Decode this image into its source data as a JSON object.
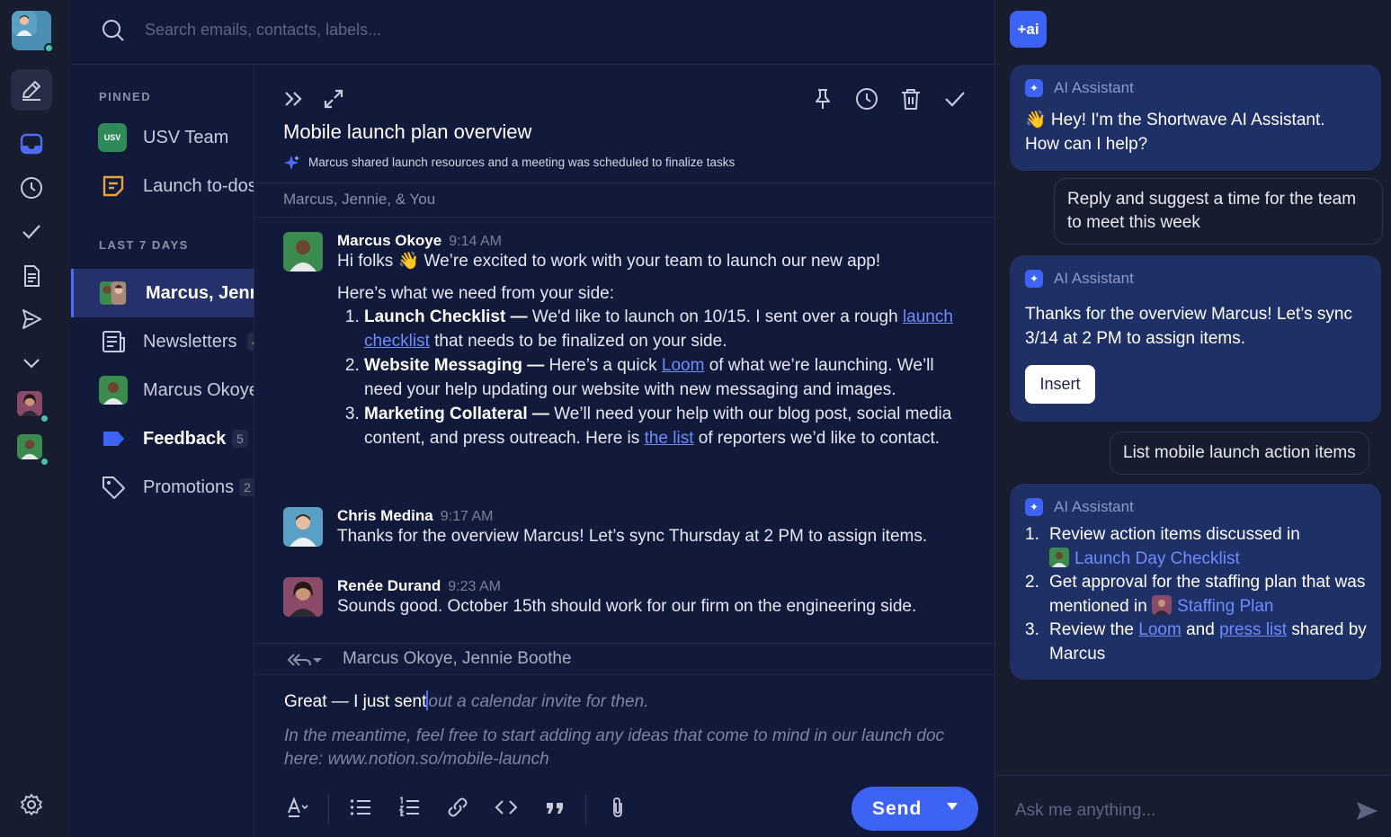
{
  "search": {
    "placeholder": "Search emails, contacts, labels..."
  },
  "sidebar": {
    "pinned_label": "PINNED",
    "last7_label": "LAST 7 DAYS",
    "pinned": [
      {
        "label": "USV Team",
        "avatar_text": "USV"
      },
      {
        "label": "Launch to-dos"
      }
    ],
    "recent": [
      {
        "label": "Marcus, Jennie"
      },
      {
        "label": "Newsletters",
        "count": "4"
      },
      {
        "label": "Marcus Okoye"
      },
      {
        "label": "Feedback",
        "count": "5"
      },
      {
        "label": "Promotions",
        "count": "2"
      }
    ]
  },
  "thread": {
    "title": "Mobile launch plan overview",
    "summary": "Marcus shared launch resources and a meeting was scheduled to finalize tasks",
    "participants": "Marcus, Jennie, & You",
    "messages": [
      {
        "name": "Marcus Okoye",
        "time": "9:14 AM",
        "greeting": "Hi folks 👋 We’re excited to work with your team to launch our new app!",
        "intro": "Here’s what we need from your side:",
        "items": [
          {
            "title": "Launch Checklist —",
            "pre": "We'd like to launch on 10/15. I sent over a rough",
            "link": "launch checklist",
            "post": "that needs to be finalized on your side."
          },
          {
            "title": "Website Messaging —",
            "pre": "Here’s a quick",
            "link": "Loom",
            "post": "of what we’re launching. We’ll need your help updating our website with new messaging and images."
          },
          {
            "title": "Marketing Collateral —",
            "pre": "We’ll need your help with our blog post, social media content, and press outreach. Here is",
            "link": "the list",
            "post": "of reporters we’d like to contact."
          }
        ]
      },
      {
        "name": "Chris Medina",
        "time": "9:17 AM",
        "text": "Thanks for the overview Marcus! Let’s sync Thursday at 2 PM to assign items."
      },
      {
        "name": "Renée Durand",
        "time": "9:23 AM",
        "text": "Sounds good. October 15th should work for our firm on the engineering side."
      }
    ],
    "reply_recipients": "Marcus Okoye, Jennie Boothe",
    "compose": {
      "typed": "Great — I just sent",
      "suggestion": "out a calendar invite for then.",
      "suggestion2": "In the meantime, feel free to start adding any ideas that come to mind in our launch doc here: www.notion.so/mobile-launch"
    },
    "send_label": "Send"
  },
  "ai": {
    "logo": "+ai",
    "assistant_name": "AI Assistant",
    "greeting": "👋 Hey! I'm the Shortwave AI Assistant. How can I help?",
    "user_msg_1": "Reply and suggest a time for the team to meet this week",
    "reply_1": "Thanks for the overview Marcus! Let’s sync 3/14 at 2 PM to assign items.",
    "insert_label": "Insert",
    "user_msg_2": "List mobile launch action items",
    "list": [
      {
        "n": "1.",
        "pre": "Review action items discussed in",
        "link": "Launch Day Checklist"
      },
      {
        "n": "2.",
        "pre": "Get approval for the staffing plan that was mentioned in",
        "link": "Staffing Plan"
      },
      {
        "n": "3.",
        "pre": "Review the",
        "link_a": "Loom",
        "mid": "and",
        "link_b": "press list",
        "post": "shared by Marcus"
      }
    ],
    "ask_placeholder": "Ask me anything..."
  },
  "colors": {
    "accent": "#3d63f5",
    "link": "#6f8cff",
    "presence": "#3fc8a8"
  }
}
